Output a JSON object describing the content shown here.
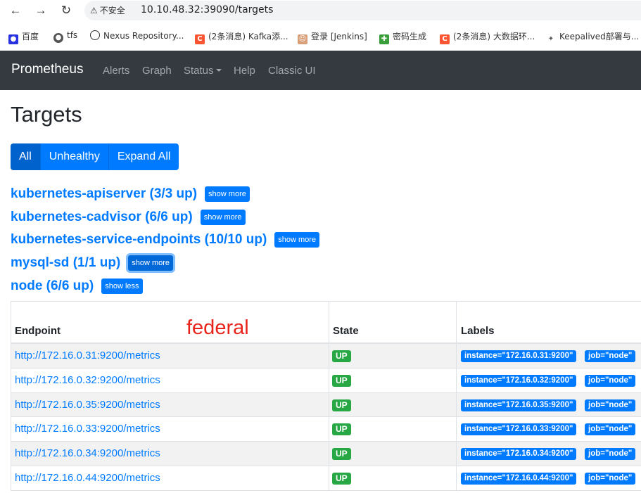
{
  "browser": {
    "security_label": "不安全",
    "url": "10.10.48.32:39090/targets",
    "bookmarks": [
      {
        "label": "百度",
        "icon": "baidu-icon",
        "color": "#2932e1"
      },
      {
        "label": "tfs",
        "icon": "tfs-icon",
        "color": "#555555"
      },
      {
        "label": "Nexus Repository...",
        "icon": "nexus-icon",
        "color": "#333333"
      },
      {
        "label": "(2条消息) Kafka添...",
        "icon": "csdn-icon",
        "color": "#fc5531"
      },
      {
        "label": "登录 [Jenkins]",
        "icon": "jenkins-icon",
        "color": "#d33833"
      },
      {
        "label": "密码生成",
        "icon": "password-icon",
        "color": "#3a9e3a"
      },
      {
        "label": "(2条消息) 大数据环...",
        "icon": "csdn-icon",
        "color": "#fc5531"
      },
      {
        "label": "Keepalived部署与...",
        "icon": "keepalived-icon",
        "color": "#555555"
      }
    ]
  },
  "navbar": {
    "brand": "Prometheus",
    "links": [
      "Alerts",
      "Graph",
      "Status",
      "Help",
      "Classic UI"
    ]
  },
  "page": {
    "title": "Targets",
    "filters": [
      "All",
      "Unhealthy",
      "Expand All"
    ]
  },
  "pools": [
    {
      "name": "kubernetes-apiserver (3/3 up)",
      "button": "show more"
    },
    {
      "name": "kubernetes-cadvisor (6/6 up)",
      "button": "show more"
    },
    {
      "name": "kubernetes-service-endpoints (10/10 up)",
      "button": "show more"
    },
    {
      "name": "mysql-sd (1/1 up)",
      "button": "show more"
    },
    {
      "name": "node (6/6 up)",
      "button": "show less"
    }
  ],
  "table": {
    "headers": [
      "Endpoint",
      "State",
      "Labels"
    ],
    "annotation": "federal",
    "rows": [
      {
        "endpoint": "http://172.16.0.31:9200/metrics",
        "state": "UP",
        "instance": "instance=\"172.16.0.31:9200\"",
        "job": "job=\"node\""
      },
      {
        "endpoint": "http://172.16.0.32:9200/metrics",
        "state": "UP",
        "instance": "instance=\"172.16.0.32:9200\"",
        "job": "job=\"node\""
      },
      {
        "endpoint": "http://172.16.0.35:9200/metrics",
        "state": "UP",
        "instance": "instance=\"172.16.0.35:9200\"",
        "job": "job=\"node\""
      },
      {
        "endpoint": "http://172.16.0.33:9200/metrics",
        "state": "UP",
        "instance": "instance=\"172.16.0.33:9200\"",
        "job": "job=\"node\""
      },
      {
        "endpoint": "http://172.16.0.34:9200/metrics",
        "state": "UP",
        "instance": "instance=\"172.16.0.34:9200\"",
        "job": "job=\"node\""
      },
      {
        "endpoint": "http://172.16.0.44:9200/metrics",
        "state": "UP",
        "instance": "instance=\"172.16.0.44:9200\"",
        "job": "job=\"node\""
      }
    ]
  },
  "colors": {
    "navbar": "#343a40",
    "primary": "#007bff",
    "success": "#28a745",
    "annotation": "#e8231a"
  }
}
